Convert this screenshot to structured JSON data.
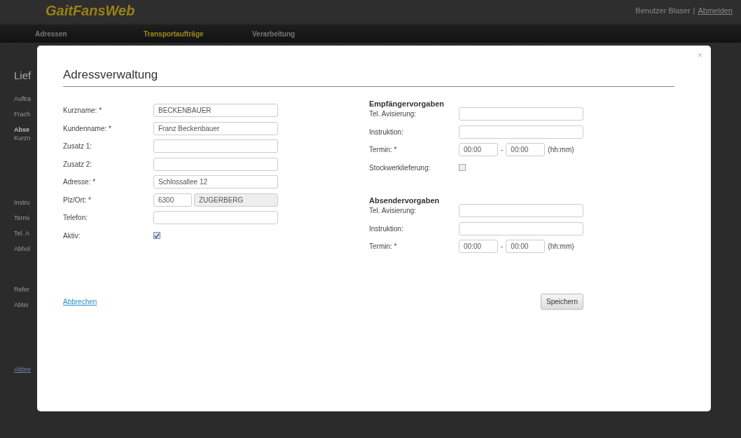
{
  "header": {
    "logo": "GaitFansWeb",
    "user": "Benutzer Blaser",
    "separator": "|",
    "logout": "Abmelden"
  },
  "nav": [
    {
      "label": "Adressen",
      "selected": false
    },
    {
      "label": "Transportaufträge",
      "selected": true
    },
    {
      "label": "Verarbeitung",
      "selected": false
    }
  ],
  "background_page": {
    "title": "Lief",
    "label_groups": [
      [
        {
          "text": "Auftra",
          "bold": false
        },
        {
          "text": "Frach",
          "bold": false
        },
        {
          "text": "Abse",
          "bold": true
        },
        {
          "text": "Kurzn",
          "bold": false
        }
      ],
      [
        {
          "text": "Instru",
          "bold": false
        },
        {
          "text": "Termi",
          "bold": false
        },
        {
          "text": "Tel. A",
          "bold": false
        },
        {
          "text": "Abhol",
          "bold": false
        }
      ],
      [
        {
          "text": "Refer",
          "bold": false
        },
        {
          "text": "Abtei",
          "bold": false
        }
      ]
    ],
    "link": "Abbre"
  },
  "dialog": {
    "title": "Adressverwaltung",
    "close": "×",
    "left_fields": [
      {
        "kind": "text",
        "label": "Kurzname: *",
        "value": "BECKENBAUER"
      },
      {
        "kind": "text",
        "label": "Kundenname: *",
        "value": "Franz Beckenbauer"
      },
      {
        "kind": "text",
        "label": "Zusatz 1:"
      },
      {
        "kind": "text",
        "label": "Zusatz 2:"
      },
      {
        "kind": "text",
        "label": "Adresse: *",
        "value": "Schlossallee 12"
      },
      {
        "kind": "plz",
        "label": "Plz/Ort: *",
        "value": "6300",
        "value2": "ZUGERBERG"
      },
      {
        "kind": "text",
        "label": "Telefon:"
      },
      {
        "kind": "checkbox",
        "label": "Aktiv:",
        "checked": true
      }
    ],
    "sections": [
      {
        "heading": "Empfängervorgaben",
        "fields": [
          {
            "kind": "text",
            "label": "Tel. Avisierung:"
          },
          {
            "kind": "text",
            "label": "Instruktion:"
          },
          {
            "kind": "time",
            "label": "Termin: *",
            "from": "00:00",
            "sep": "-",
            "to": "00:00",
            "hint": "(hh:mm)"
          },
          {
            "kind": "checkbox",
            "label": "Stockwerklieferung:",
            "checked": false
          }
        ]
      },
      {
        "heading": "Absendervorgaben",
        "fields": [
          {
            "kind": "text",
            "label": "Tel. Avisierung:"
          },
          {
            "kind": "text",
            "label": "Instruktion:"
          },
          {
            "kind": "time",
            "label": "Termin: *",
            "from": "00:00",
            "sep": "-",
            "to": "00:00",
            "hint": "(hh:mm)"
          }
        ]
      }
    ],
    "cancel": "Abbrechen",
    "save": "Speichern"
  }
}
